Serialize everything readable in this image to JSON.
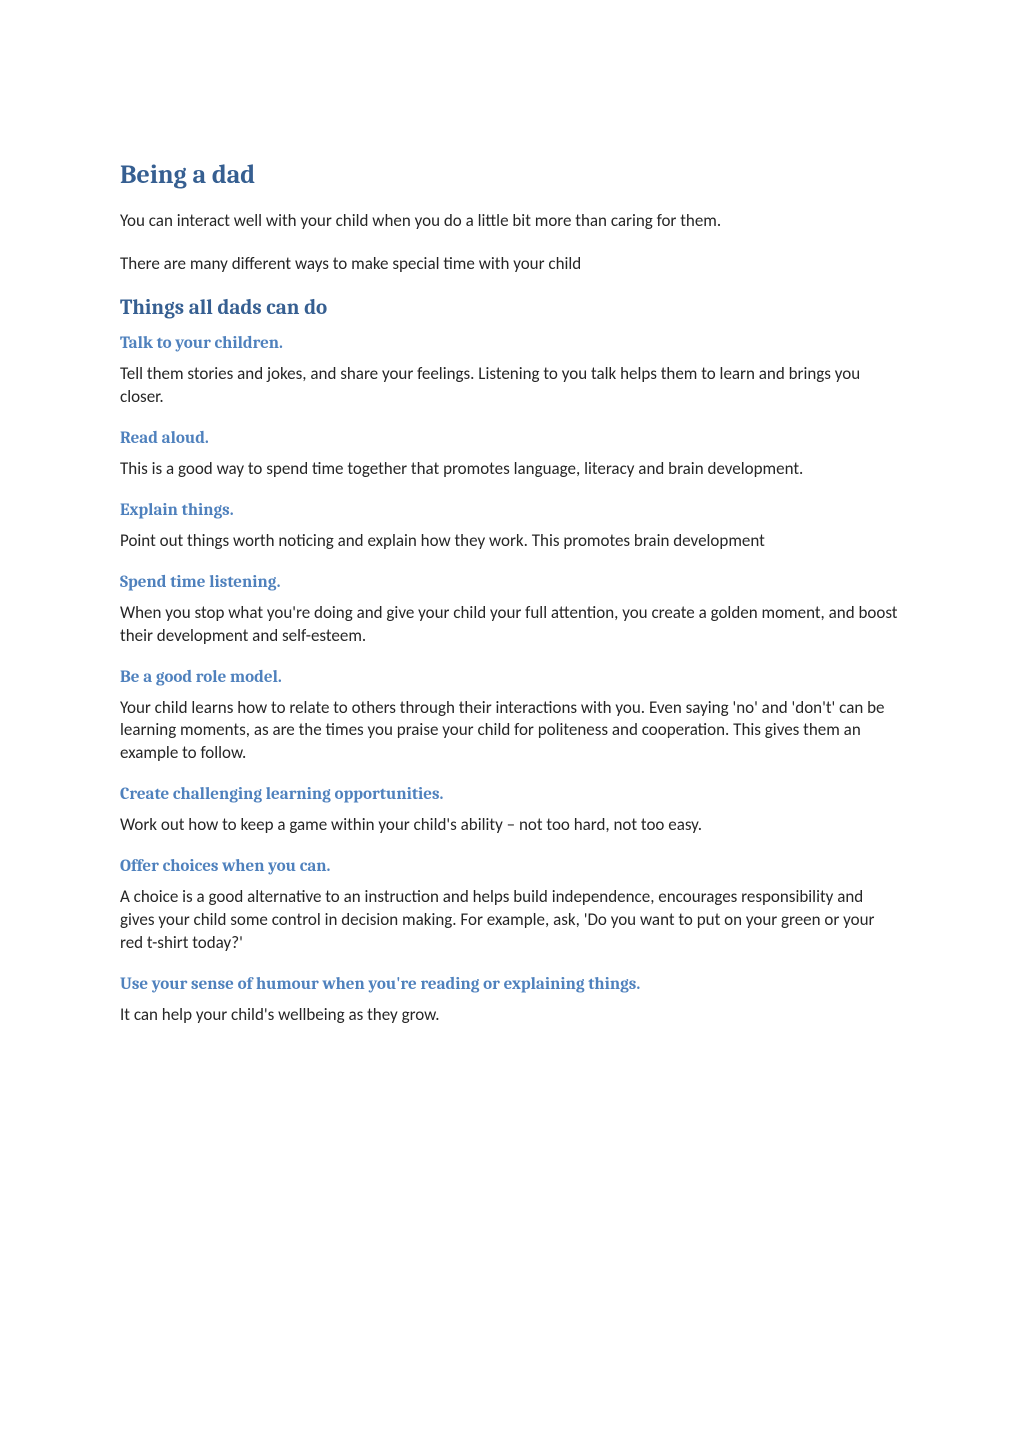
{
  "title": "Being a dad",
  "intro": [
    "You can interact well with your child when you do a little bit more than caring for them.",
    "There are many different ways to make special time with your child"
  ],
  "subheading": "Things all dads can do",
  "sections": [
    {
      "heading": "Talk to your children.",
      "body": "Tell them stories and jokes, and share your feelings. Listening to you talk helps them to learn and brings you closer."
    },
    {
      "heading": "Read aloud.",
      "body": "This is a good way to spend time together that promotes language, literacy and brain development."
    },
    {
      "heading": "Explain things.",
      "body": "Point out things worth noticing and explain how they work. This promotes brain development"
    },
    {
      "heading": "Spend time listening.",
      "body": "When you stop what you're doing and give your child your full attention, you create a golden moment, and boost their development and self-esteem."
    },
    {
      "heading": "Be a good role model.",
      "body": "Your child learns how to relate to others through their interactions with you. Even saying 'no' and 'don't' can be learning moments, as are the times you praise your child for politeness and cooperation. This gives them an example to follow."
    },
    {
      "heading": "Create challenging learning opportunities.",
      "body": "Work out how to keep a game within your child's ability – not too hard, not too easy."
    },
    {
      "heading": "Offer choices when you can.",
      "body": "A choice is a good alternative to an instruction and helps build independence, encourages responsibility and gives your child some control in decision making. For example, ask, 'Do you want to put on your green or your red t-shirt today?'"
    },
    {
      "heading": "Use your sense of humour when you're reading or explaining things.",
      "body": "It can help your child's wellbeing as they grow."
    }
  ]
}
